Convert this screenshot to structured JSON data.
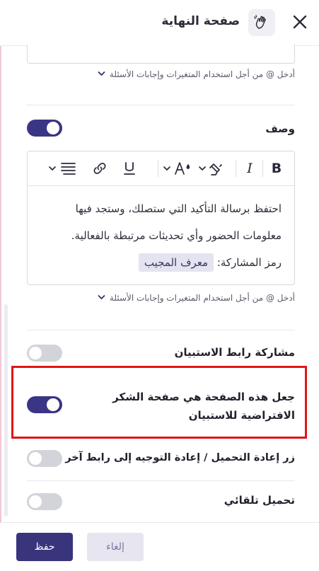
{
  "header": {
    "title": "صفحة النهاية",
    "panel_icon": "waving-hand-icon",
    "close_icon": "close-icon"
  },
  "top_hint": "أدخل @ من أجل استخدام المتغيرات وإجابات الأسئلة",
  "description": {
    "label": "وصف",
    "enabled": true,
    "toolbar": {
      "bold": "B",
      "italic": "I",
      "underline": "U",
      "font_size": "A",
      "icons": [
        "bold-icon",
        "italic-icon",
        "highlight-color-icon",
        "font-size-icon",
        "underline-icon",
        "link-icon",
        "align-icon"
      ]
    },
    "body_line1": "احتفظ برسالة التأكيد التي ستصلك، وستجد فيها",
    "body_line2": "معلومات الحضور وأي تحديثات مرتبطة بالفعالية.",
    "code_label": "رمز المشاركة:",
    "code_chip": "معرف المجيب",
    "hint": "أدخل @ من أجل استخدام المتغيرات وإجابات الأسئلة"
  },
  "settings": [
    {
      "label": "مشاركة رابط الاستبيان",
      "enabled": false
    },
    {
      "label": "جعل هذه الصفحة هي صفحة الشكر الافتراضية للاستبيان",
      "label_line1": "جعل هذه الصفحة هي صفحة الشكر",
      "label_line2": "الافتراضية للاستبيان",
      "enabled": true
    },
    {
      "label": "زر إعادة التحميل / إعادة التوجيه إلى رابط آخر",
      "enabled": false
    },
    {
      "label": "تحميل تلقائي",
      "enabled": false
    }
  ],
  "footer": {
    "save_label": "حفظ",
    "cancel_label": "إلغاء"
  },
  "colors": {
    "accent": "#38357c",
    "toggle_off": "#d3d3da",
    "highlight": "#e11515"
  }
}
